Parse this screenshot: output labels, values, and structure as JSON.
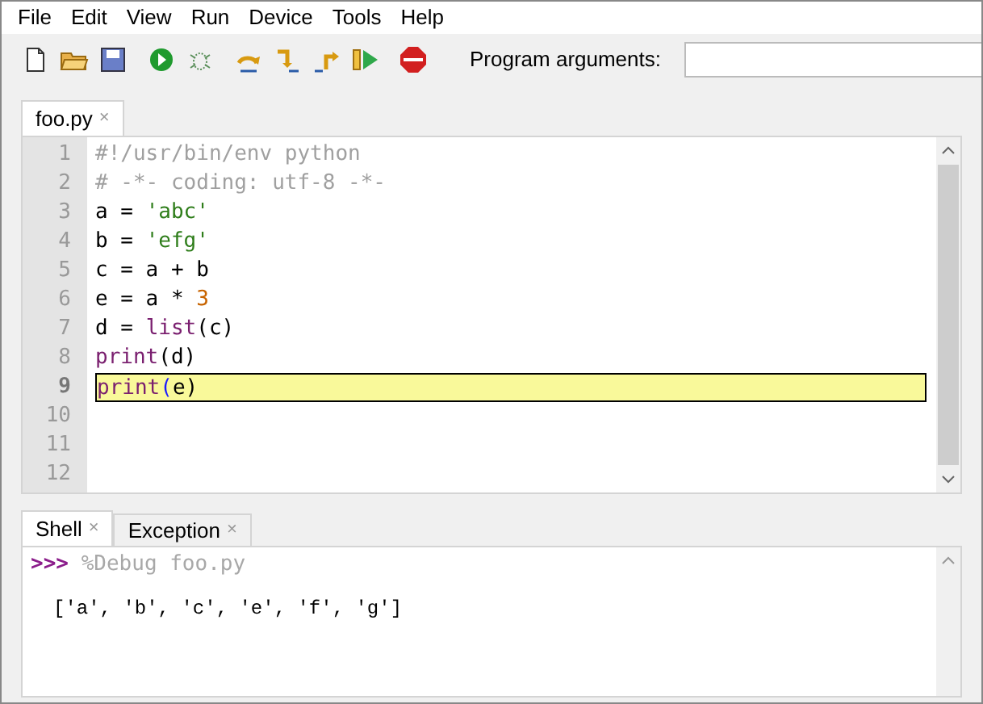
{
  "menu": [
    "File",
    "Edit",
    "View",
    "Run",
    "Device",
    "Tools",
    "Help"
  ],
  "toolbar": {
    "args_label": "Program arguments:"
  },
  "editor_tabs": [
    {
      "label": "foo.py",
      "close": "×",
      "selected": true
    }
  ],
  "code": [
    {
      "number": "1",
      "current": false,
      "tokens": [
        {
          "text": "#!/usr/bin/env python",
          "kind": "comment"
        }
      ]
    },
    {
      "number": "2",
      "current": false,
      "tokens": [
        {
          "text": "# -*- coding: utf-8 -*-",
          "kind": "comment"
        }
      ]
    },
    {
      "number": "3",
      "current": false,
      "tokens": [
        {
          "text": "a = ",
          "kind": "plain"
        },
        {
          "text": "'abc'",
          "kind": "string"
        }
      ]
    },
    {
      "number": "4",
      "current": false,
      "tokens": [
        {
          "text": "b = ",
          "kind": "plain"
        },
        {
          "text": "'efg'",
          "kind": "string"
        }
      ]
    },
    {
      "number": "5",
      "current": false,
      "tokens": [
        {
          "text": "c = a + b",
          "kind": "plain"
        }
      ]
    },
    {
      "number": "6",
      "current": false,
      "tokens": [
        {
          "text": "e = a * ",
          "kind": "plain"
        },
        {
          "text": "3",
          "kind": "number"
        }
      ]
    },
    {
      "number": "7",
      "current": false,
      "tokens": [
        {
          "text": "d = ",
          "kind": "plain"
        },
        {
          "text": "list",
          "kind": "builtin"
        },
        {
          "text": "(c)",
          "kind": "plain"
        }
      ]
    },
    {
      "number": "8",
      "current": false,
      "tokens": [
        {
          "text": "print",
          "kind": "builtin"
        },
        {
          "text": "(d)",
          "kind": "plain"
        }
      ]
    },
    {
      "number": "9",
      "current": true,
      "tokens": [
        {
          "text": "print",
          "kind": "builtin"
        },
        {
          "text": "(",
          "kind": "paren"
        },
        {
          "text": "e)",
          "kind": "plain"
        }
      ]
    },
    {
      "number": "10",
      "current": false
    },
    {
      "number": "11",
      "current": false
    },
    {
      "number": "12",
      "current": false
    }
  ],
  "shell_tabs": [
    {
      "label": "Shell",
      "close": "×",
      "selected": true
    },
    {
      "label": "Exception",
      "close": "×",
      "selected": false
    }
  ],
  "shell": {
    "prompt": ">>>",
    "command": "%Debug foo.py",
    "output": "['a', 'b', 'c', 'e', 'f', 'g']"
  }
}
